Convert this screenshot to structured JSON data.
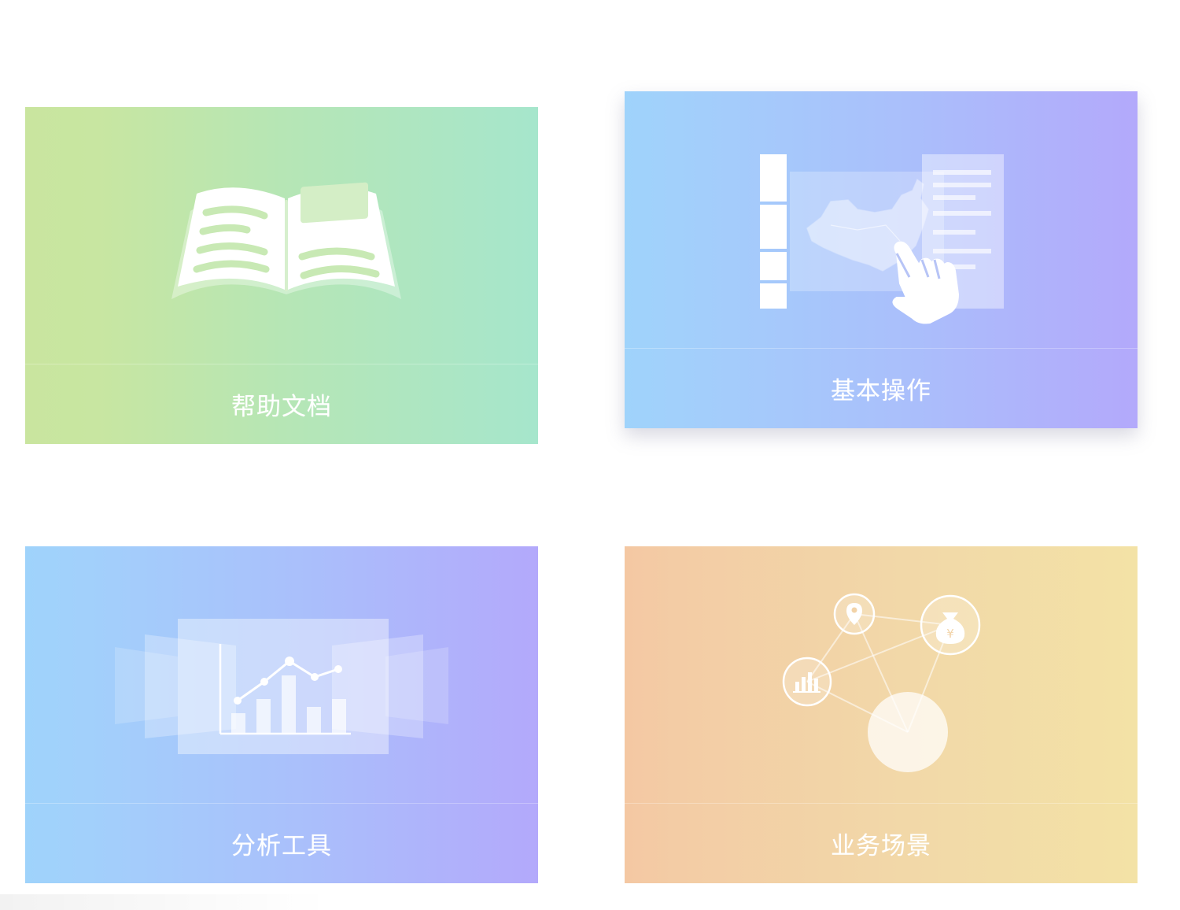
{
  "cards": [
    {
      "id": "help",
      "label": "帮助文档",
      "icon": "open-book-icon",
      "gradient": [
        "#c9e59f",
        "#a6e6cc"
      ]
    },
    {
      "id": "ops",
      "label": "基本操作",
      "icon": "map-interaction-icon",
      "gradient": [
        "#9fd3fb",
        "#b3a9fb"
      ]
    },
    {
      "id": "tools",
      "label": "分析工具",
      "icon": "chart-panels-icon",
      "gradient": [
        "#9fd3fb",
        "#b3a9fb"
      ]
    },
    {
      "id": "scene",
      "label": "业务场景",
      "icon": "network-nodes-icon",
      "gradient": [
        "#f4c8a3",
        "#f3e2a6"
      ]
    }
  ],
  "icons": {
    "money_symbol": "¥"
  }
}
